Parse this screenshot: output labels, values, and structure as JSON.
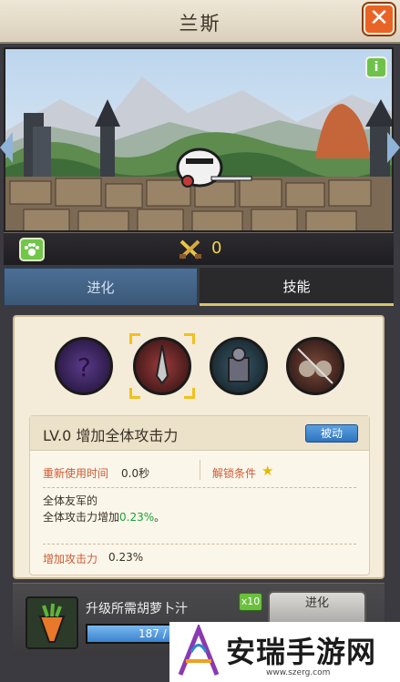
{
  "window": {
    "title": "兰斯",
    "close_glyph": "✕"
  },
  "scene": {
    "info_glyph": "i"
  },
  "stats": {
    "count": "0"
  },
  "tabs": [
    {
      "label": "进化",
      "active": false
    },
    {
      "label": "技能",
      "active": true
    }
  ],
  "skills": [
    {
      "icon": "curse-skill-icon"
    },
    {
      "icon": "sword-skill-icon",
      "selected": true
    },
    {
      "icon": "sentry-skill-icon"
    },
    {
      "icon": "dual-blade-skill-icon"
    }
  ],
  "skill_detail": {
    "level_title": "LV.0 增加全体攻击力",
    "type_label": "被动",
    "cooldown_label": "重新使用时间",
    "cooldown_value": "0.0秒",
    "unlock_label": "解锁条件",
    "desc_line1": "全体友军的",
    "desc_line2_prefix": "全体攻击力增加",
    "desc_line2_value": "0.23%",
    "desc_line2_suffix": "。",
    "bonus_label": "增加攻击力",
    "bonus_value": "0.23%"
  },
  "upgrade": {
    "requirement_label": "升级所需胡萝卜汁",
    "multiplier": "x10",
    "evolve_label": "进化",
    "progress_text": "187 / 1",
    "progress_fraction": 1.0
  },
  "watermark": {
    "text": "安瑞手游网",
    "url": "www.szerg.com"
  },
  "colors": {
    "accent_orange": "#ea6326",
    "tab_blue": "#4d6f95",
    "highlight_green": "#17a43a",
    "label_red": "#cf5a34"
  }
}
